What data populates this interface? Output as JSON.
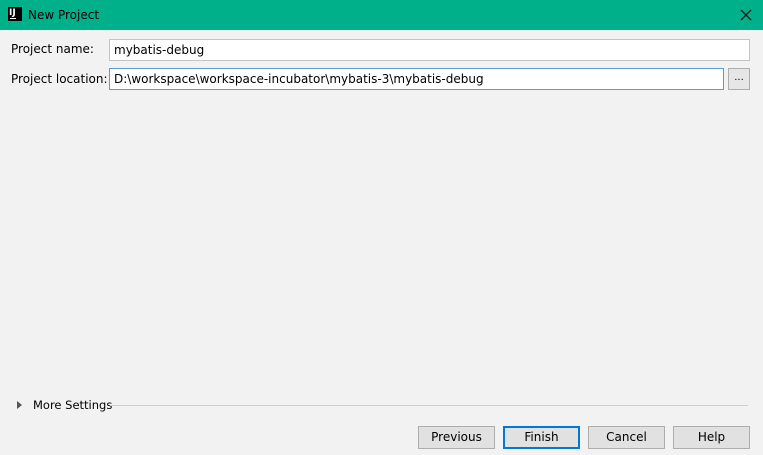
{
  "window": {
    "title": "New Project",
    "icon_text": "IJ",
    "titlebar_color": "#00b08a"
  },
  "form": {
    "name_label": "Project name:",
    "name_value": "mybatis-debug",
    "location_label": "Project location:",
    "location_value": "D:\\workspace\\workspace-incubator\\mybatis-3\\mybatis-debug",
    "browse_label": "..."
  },
  "more_settings": {
    "label": "More Settings"
  },
  "buttons": {
    "previous": "Previous",
    "finish": "Finish",
    "cancel": "Cancel",
    "help": "Help"
  }
}
